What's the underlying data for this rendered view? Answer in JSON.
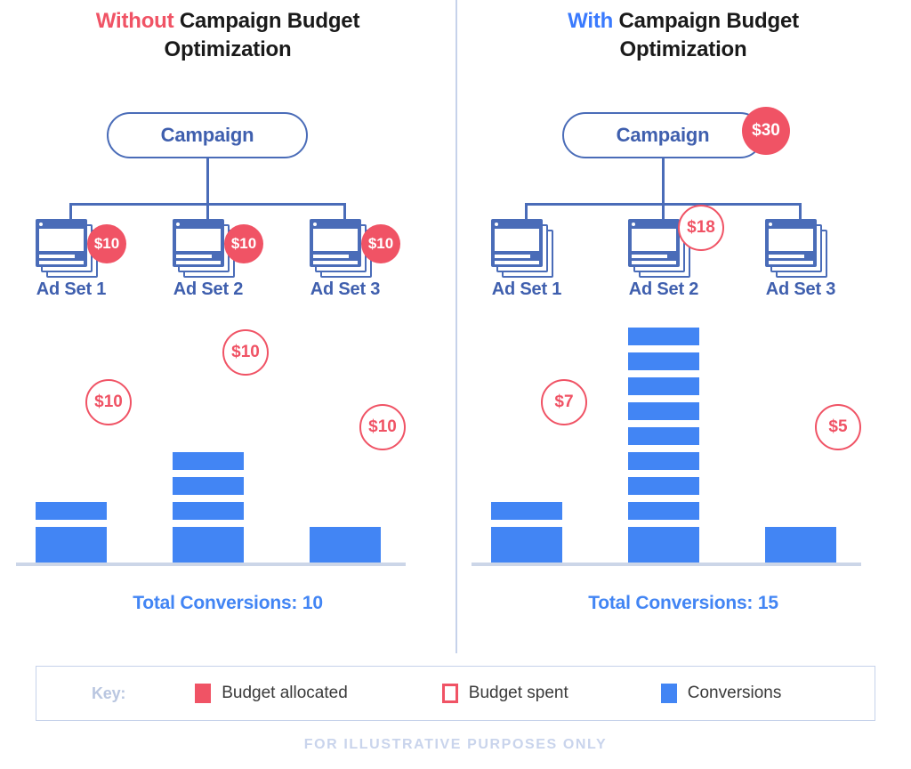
{
  "panels": [
    {
      "id": "without",
      "title_highlight": "Without",
      "title_rest": " Campaign Budget",
      "title_line2": "Optimization",
      "campaign": {
        "label": "Campaign",
        "budget_badge": null
      },
      "ad_sets": [
        {
          "label": "Ad Set 1",
          "allocated": "$10"
        },
        {
          "label": "Ad Set 2",
          "allocated": "$10"
        },
        {
          "label": "Ad Set 3",
          "allocated": "$10"
        }
      ],
      "total_conversions": "Total Conversions: 10"
    },
    {
      "id": "with",
      "title_highlight": "With",
      "title_rest": " Campaign Budget",
      "title_line2": "Optimization",
      "campaign": {
        "label": "Campaign",
        "budget_badge": "$30"
      },
      "ad_sets": [
        {
          "label": "Ad Set 1",
          "allocated": null
        },
        {
          "label": "Ad Set 2",
          "allocated": null
        },
        {
          "label": "Ad Set 3",
          "allocated": null
        }
      ],
      "total_conversions": "Total Conversions: 15"
    }
  ],
  "key": {
    "label": "Key:",
    "items": [
      {
        "swatch": "filled-red",
        "label": "Budget allocated"
      },
      {
        "swatch": "hollow-red",
        "label": "Budget spent"
      },
      {
        "swatch": "filled-blue",
        "label": "Conversions"
      }
    ]
  },
  "footer_note": "FOR ILLUSTRATIVE PURPOSES ONLY",
  "colors": {
    "red": "#f05365",
    "bright_blue": "#4285f4",
    "icon_blue": "#4a6cb8",
    "title_blue": "#3a7afe",
    "divider": "#c6d2ea",
    "muted_blue": "#c9d4ec"
  },
  "chart_data": [
    {
      "type": "bar",
      "title": "Without Campaign Budget Optimization",
      "subtitle": "Total Conversions: 10",
      "categories": [
        "Ad Set 1",
        "Ad Set 2",
        "Ad Set 3"
      ],
      "values": [
        3,
        5,
        2
      ],
      "series": [
        {
          "name": "Conversions",
          "values": [
            3,
            5,
            2
          ]
        },
        {
          "name": "Budget allocated",
          "values": [
            10,
            10,
            10
          ]
        },
        {
          "name": "Budget spent",
          "values": [
            10,
            10,
            10
          ]
        }
      ],
      "segment_counts": [
        3,
        5,
        2
      ],
      "spent_labels": [
        "$10",
        "$10",
        "$10"
      ],
      "allocated_labels": [
        "$10",
        "$10",
        "$10"
      ],
      "campaign_budget": 30,
      "total": 10,
      "xlabel": "",
      "ylabel": "Conversions",
      "ylim": [
        0,
        10
      ],
      "grid": false,
      "legend": "bottom"
    },
    {
      "type": "bar",
      "title": "With Campaign Budget Optimization",
      "subtitle": "Total Conversions: 15",
      "categories": [
        "Ad Set 1",
        "Ad Set 2",
        "Ad Set 3"
      ],
      "values": [
        3,
        10,
        2
      ],
      "series": [
        {
          "name": "Conversions",
          "values": [
            3,
            10,
            2
          ]
        },
        {
          "name": "Budget spent",
          "values": [
            7,
            18,
            5
          ]
        }
      ],
      "segment_counts": [
        3,
        10,
        2
      ],
      "spent_labels": [
        "$7",
        "$18",
        "$5"
      ],
      "allocated_labels": [
        null,
        null,
        null
      ],
      "campaign_budget": 30,
      "campaign_budget_label": "$30",
      "total": 15,
      "xlabel": "",
      "ylabel": "Conversions",
      "ylim": [
        0,
        10
      ],
      "grid": false,
      "legend": "bottom"
    }
  ]
}
